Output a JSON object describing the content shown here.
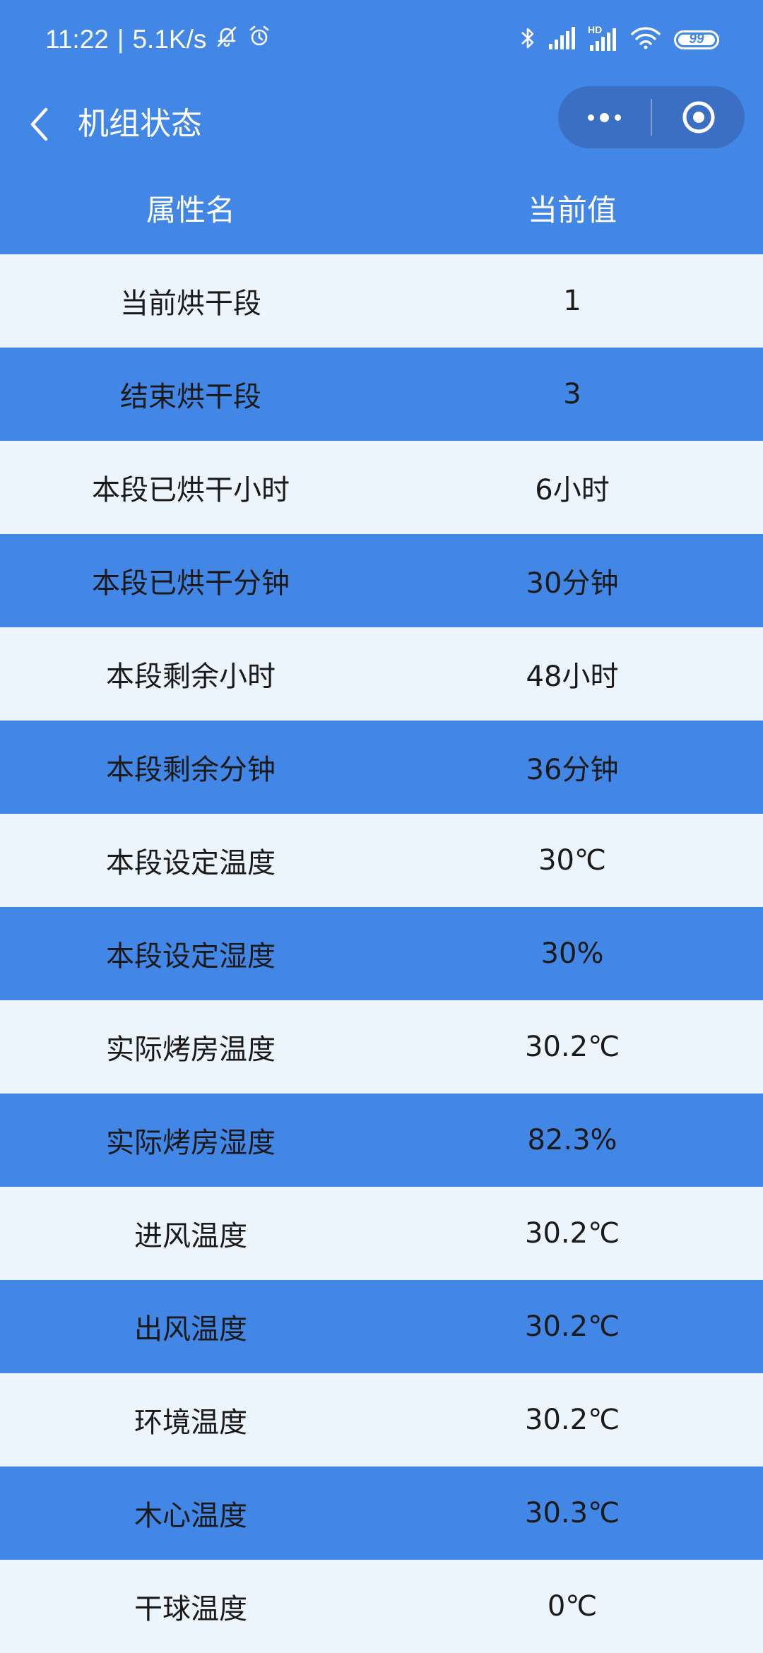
{
  "status_bar": {
    "time": "11:22",
    "separator": "|",
    "net_speed": "5.1K/s",
    "hd_label": "HD",
    "battery": "99"
  },
  "nav": {
    "title": "机组状态"
  },
  "table": {
    "headers": [
      "属性名",
      "当前值"
    ],
    "rows": [
      [
        "当前烘干段",
        "1"
      ],
      [
        "结束烘干段",
        "3"
      ],
      [
        "本段已烘干小时",
        "6小时"
      ],
      [
        "本段已烘干分钟",
        "30分钟"
      ],
      [
        "本段剩余小时",
        "48小时"
      ],
      [
        "本段剩余分钟",
        "36分钟"
      ],
      [
        "本段设定温度",
        "30℃"
      ],
      [
        "本段设定湿度",
        "30%"
      ],
      [
        "实际烤房温度",
        "30.2℃"
      ],
      [
        "实际烤房湿度",
        "82.3%"
      ],
      [
        "进风温度",
        "30.2℃"
      ],
      [
        "出风温度",
        "30.2℃"
      ],
      [
        "环境温度",
        "30.2℃"
      ],
      [
        "木心温度",
        "30.3℃"
      ],
      [
        "干球温度",
        "0℃"
      ]
    ]
  },
  "colors": {
    "primary": "#4287e6",
    "light_row": "#edf5fc",
    "capsule": "#3a6fc4"
  }
}
